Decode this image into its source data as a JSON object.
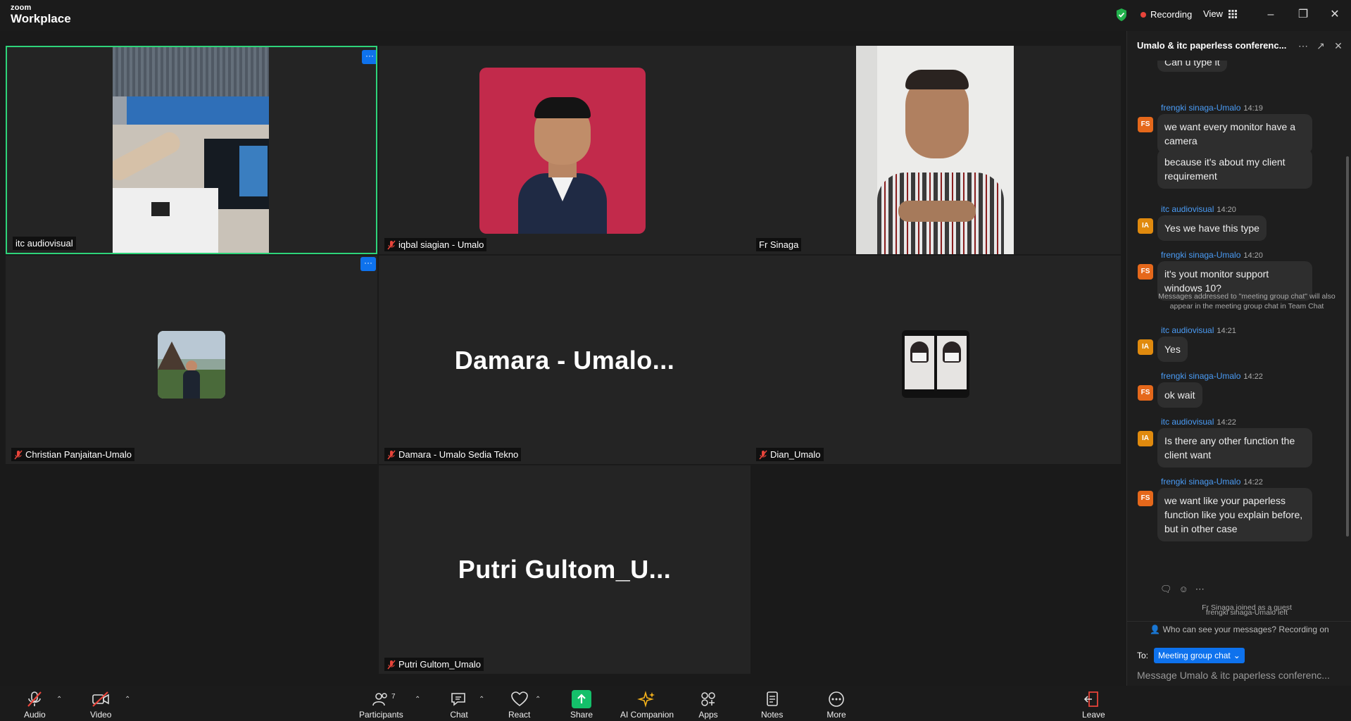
{
  "app": {
    "brand_top": "zoom",
    "brand_bottom": "Workplace"
  },
  "titlebar": {
    "recording_label": "Recording",
    "view_label": "View"
  },
  "tiles": [
    {
      "name": "itc audiovisual",
      "muted": false
    },
    {
      "name": "iqbal siagian - Umalo",
      "muted": true
    },
    {
      "name": "Fr Sinaga",
      "muted": false
    },
    {
      "name": "Christian Panjaitan-Umalo",
      "muted": true
    },
    {
      "name": "Damara - Umalo Sedia Tekno",
      "muted": true,
      "display_name": "Damara  -  Umalo..."
    },
    {
      "name": "Dian_Umalo",
      "muted": true
    },
    {
      "name": "Putri Gultom_Umalo",
      "muted": true,
      "display_name": "Putri  Gultom_U..."
    }
  ],
  "tile_menu": "···",
  "chat": {
    "title": "Umalo & itc paperless conferenc...",
    "partial_top": "Can u type it",
    "messages": [
      {
        "initials": "FS",
        "sender": "frengki sinaga-Umalo",
        "time": "14:19",
        "bubbles": [
          "we want every monitor have a camera",
          "because it's about my client requirement"
        ]
      },
      {
        "initials": "IA",
        "sender": "itc audiovisual",
        "time": "14:20",
        "bubbles": [
          "Yes we have this type"
        ]
      },
      {
        "initials": "FS",
        "sender": "frengki sinaga-Umalo",
        "time": "14:20",
        "bubbles": [
          "it's yout monitor support windows 10?"
        ]
      },
      {
        "initials": "IA",
        "sender": "itc audiovisual",
        "time": "14:21",
        "bubbles": [
          "Yes"
        ]
      },
      {
        "initials": "FS",
        "sender": "frengki sinaga-Umalo",
        "time": "14:22",
        "bubbles": [
          "ok wait"
        ]
      },
      {
        "initials": "IA",
        "sender": "itc audiovisual",
        "time": "14:22",
        "bubbles": [
          "Is there any other function the client want"
        ]
      },
      {
        "initials": "FS",
        "sender": "frengki sinaga-Umalo",
        "time": "14:22",
        "bubbles": [
          "we want like your paperless function like you explain before, but in other case"
        ]
      }
    ],
    "system_note": "Messages addressed to \"meeting group chat\" will also appear in the meeting group chat in Team Chat",
    "left_note": "frengki sinaga-Umalo left",
    "joined_note": "Fr Sinaga joined as a guest",
    "privacy": "Who can see your messages? Recording on",
    "to_label": "To:",
    "to_value": "Meeting group chat",
    "input_placeholder": "Message Umalo & itc paperless conferenc..."
  },
  "toolbar": {
    "audio": "Audio",
    "video": "Video",
    "participants": "Participants",
    "participants_count": "7",
    "chat": "Chat",
    "react": "React",
    "share": "Share",
    "ai": "AI Companion",
    "apps": "Apps",
    "notes": "Notes",
    "more": "More",
    "leave": "Leave"
  },
  "colors": {
    "accent": "#0e72ed",
    "active_speaker": "#2ed47a",
    "record": "#e8443a",
    "share": "#14c06a",
    "leave": "#e8443a"
  }
}
